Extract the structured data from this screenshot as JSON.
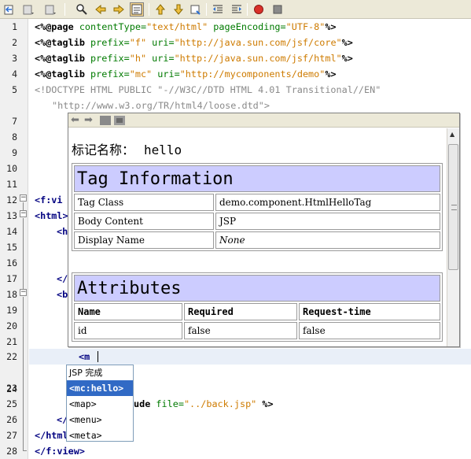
{
  "toolbar": {
    "buttons": [
      "back-icon",
      "forward-menu-icon",
      "forward-icon",
      "find-icon",
      "find-prev-icon",
      "find-next-icon",
      "toggle-highlight-icon",
      "prev-bookmark-icon",
      "next-bookmark-icon",
      "toggle-bookmark-icon",
      "shift-left-icon",
      "shift-right-icon",
      "record-macro-icon",
      "stop-macro-icon"
    ]
  },
  "gutter": {
    "lines": [
      "1",
      "2",
      "3",
      "4",
      "5",
      "",
      "7",
      "8",
      "9",
      "10",
      "11",
      "12",
      "13",
      "14",
      "15",
      "16",
      "17",
      "18",
      "19",
      "20",
      "21",
      "22",
      "23",
      "24",
      "25",
      "26",
      "27",
      "28"
    ]
  },
  "code": {
    "l1": {
      "kw": "<%@page",
      "a1": " contentType=",
      "s1": "\"text/html\"",
      "a2": " pageEncoding=",
      "s2": "\"UTF-8\"",
      "e": "%>"
    },
    "l2": {
      "kw": "<%@taglib",
      "a1": " prefix=",
      "s1": "\"f\"",
      "a2": " uri=",
      "s2": "\"http://java.sun.com/jsf/core\"",
      "e": "%>"
    },
    "l3": {
      "kw": "<%@taglib",
      "a1": " prefix=",
      "s1": "\"h\"",
      "a2": " uri=",
      "s2": "\"http://java.sun.com/jsf/html\"",
      "e": "%>"
    },
    "l4": {
      "kw": "<%@taglib",
      "a1": " prefix=",
      "s1": "\"mc\"",
      "a2": " uri=",
      "s2": "\"http://mycomponents/demo\"",
      "e": "%>"
    },
    "l5": "<!DOCTYPE HTML PUBLIC \"-//W3C//DTD HTML 4.01 Transitional//EN\"",
    "l5b": "\"http://www.w3.org/TR/html4/loose.dtd\">",
    "l12": "<f:vi",
    "l13": "<html>",
    "l14": "<h",
    "l17": "</",
    "l18": "<b",
    "l22": "<m",
    "l25": {
      "kw": "ude",
      "a1": " file=",
      "s1": "\"../back.jsp\"",
      "e": " %>"
    },
    "l26": "</",
    "l27": "</html",
    "l28": "</f:view>"
  },
  "doc_popup": {
    "tag_name_label": "标记名称：",
    "tag_name_value": "hello",
    "tag_info_title": "Tag Information",
    "tag_info_rows": [
      [
        "Tag Class",
        "demo.component.HtmlHelloTag"
      ],
      [
        "Body Content",
        "JSP"
      ],
      [
        "Display Name",
        "None"
      ]
    ],
    "attributes_title": "Attributes",
    "attributes_headers": [
      "Name",
      "Required",
      "Request-time"
    ],
    "attributes_rows": [
      [
        "id",
        "false",
        "false"
      ]
    ]
  },
  "completion": {
    "header": "JSP 完成",
    "items": [
      "<mc:hello>",
      "<map>",
      "<menu>",
      "<meta>"
    ],
    "selected": 0
  }
}
